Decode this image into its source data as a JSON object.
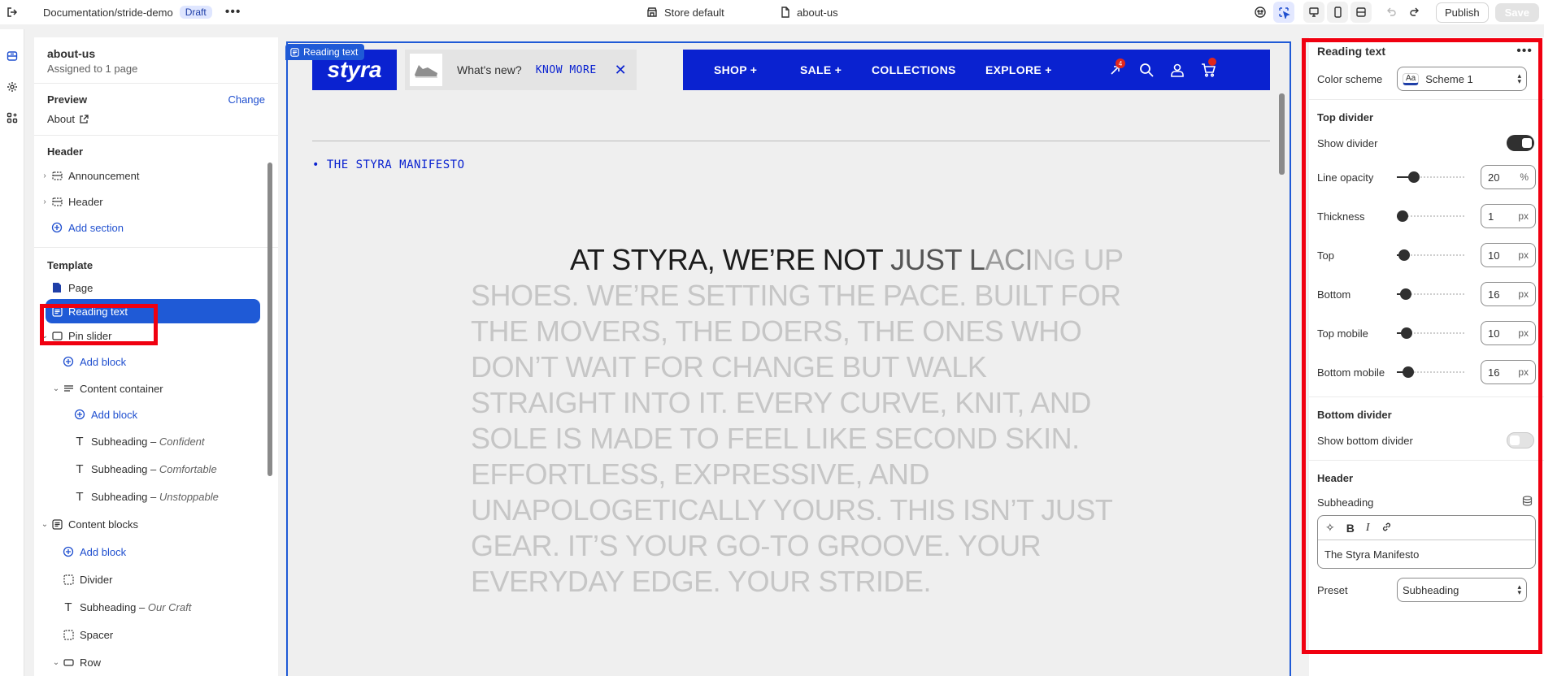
{
  "topbar": {
    "title": "Documentation/stride-demo",
    "status_badge": "Draft",
    "more": "•••",
    "theme_name": "Store default",
    "page_name": "about-us",
    "publish_label": "Publish",
    "save_label": "Save"
  },
  "left_panel": {
    "template_name": "about-us",
    "assigned": "Assigned to 1 page",
    "preview_label": "Preview",
    "change_label": "Change",
    "preview_page": "About",
    "header_section_title": "Header",
    "header_items": [
      "Announcement",
      "Header"
    ],
    "add_section_label": "Add section",
    "template_section_title": "Template",
    "page_label": "Page",
    "selected_label": "Reading text",
    "pin_slider_label": "Pin slider",
    "add_block_label": "Add block",
    "content_container_label": "Content container",
    "subheadings": [
      {
        "prefix": "Subheading – ",
        "name": "Confident"
      },
      {
        "prefix": "Subheading – ",
        "name": "Comfortable"
      },
      {
        "prefix": "Subheading – ",
        "name": "Unstoppable"
      }
    ],
    "content_blocks_label": "Content blocks",
    "divider_label": "Divider",
    "our_craft": {
      "prefix": "Subheading – ",
      "name": "Our Craft"
    },
    "spacer_label": "Spacer",
    "row_label": "Row"
  },
  "canvas": {
    "tag_label": "Reading text",
    "logo_text": "styra",
    "promo_text": "What's new?",
    "promo_link": "KNOW MORE",
    "promo_close": "✕",
    "nav": [
      "SHOP +",
      "SALE +",
      "COLLECTIONS",
      "EXPLORE +"
    ],
    "rewards_count": "4",
    "eyebrow": "• THE STYRA MANIFESTO",
    "manifesto_dark": "AT STYRA, WE’RE NOT ",
    "manifesto_mid": "JUST L",
    "manifesto_light": "ACI",
    "manifesto_rest": "NG UP SHOES. WE’RE SETTING THE PACE. BUILT FOR THE MOVERS, THE DOERS, THE ONES WHO DON’T WAIT FOR CHANGE BUT WALK STRAIGHT INTO IT. EVERY CURVE, KNIT, AND SOLE IS MADE TO FEEL LIKE SECOND SKIN. EFFORTLESS, EXPRESSIVE, AND UNAPOLOGETICALLY YOURS. THIS ISN’T JUST GEAR. IT’S YOUR GO-TO GROOVE. YOUR EVERYDAY EDGE. YOUR STRIDE."
  },
  "right_panel": {
    "title": "Reading text",
    "more": "•••",
    "color_scheme_label": "Color scheme",
    "color_scheme_value": "Scheme 1",
    "color_scheme_icon": "Aa",
    "top_divider_title": "Top divider",
    "show_divider_label": "Show divider",
    "show_divider_on": true,
    "sliders": [
      {
        "label": "Line opacity",
        "value": "20",
        "unit": "%",
        "level": 0.2
      },
      {
        "label": "Thickness",
        "value": "1",
        "unit": "px",
        "level": 0.0
      },
      {
        "label": "Top",
        "value": "10",
        "unit": "px",
        "level": 0.03
      },
      {
        "label": "Bottom",
        "value": "16",
        "unit": "px",
        "level": 0.05
      },
      {
        "label": "Top mobile",
        "value": "10",
        "unit": "px",
        "level": 0.07
      },
      {
        "label": "Bottom mobile",
        "value": "16",
        "unit": "px",
        "level": 0.1
      }
    ],
    "bottom_divider_title": "Bottom divider",
    "show_bottom_divider_label": "Show bottom divider",
    "show_bottom_divider_on": false,
    "header_title": "Header",
    "subheading_label": "Subheading",
    "subheading_value": "The Styra Manifesto",
    "preset_label": "Preset",
    "preset_value": "Subheading"
  },
  "colors": {
    "accent": "#1f5ad6",
    "brand_blue": "#0a22d0",
    "highlight": "#f00010"
  }
}
